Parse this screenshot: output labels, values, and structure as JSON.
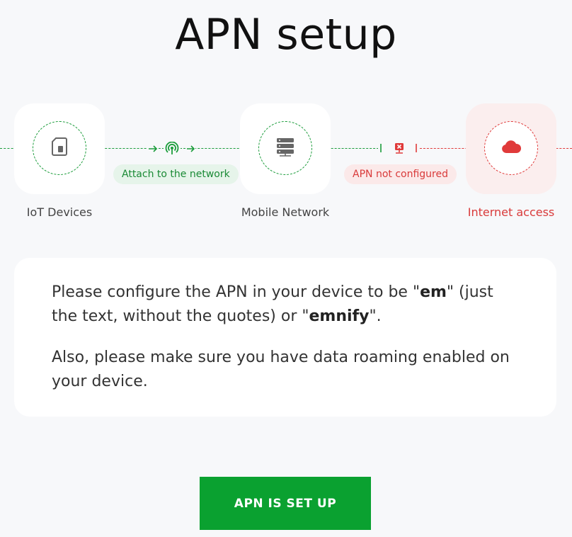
{
  "title": "APN setup",
  "diagram": {
    "nodes": [
      {
        "label": "IoT Devices",
        "icon": "sim-card-icon",
        "status": "ok"
      },
      {
        "label": "Mobile Network",
        "icon": "server-icon",
        "status": "ok"
      },
      {
        "label": "Internet access",
        "icon": "cloud-icon",
        "status": "error"
      }
    ],
    "links": [
      {
        "label": "Attach to the network",
        "icon": "antenna-icon",
        "status": "ok"
      },
      {
        "label": "APN not configured",
        "icon": "network-error-icon",
        "status": "error"
      }
    ]
  },
  "info": {
    "p1_pre": "Please configure the APN in your device to be \"",
    "apn_primary": "em",
    "p1_mid": "\" (just the text, without the quotes) or \"",
    "apn_secondary": "emnify",
    "p1_post": "\".",
    "p2": "Also, please make sure you have data roaming enabled on your device."
  },
  "action": {
    "label": "APN IS SET UP"
  },
  "colors": {
    "ok": "#1a9c3a",
    "error": "#e03a3a",
    "primary_button": "#0aa130"
  }
}
